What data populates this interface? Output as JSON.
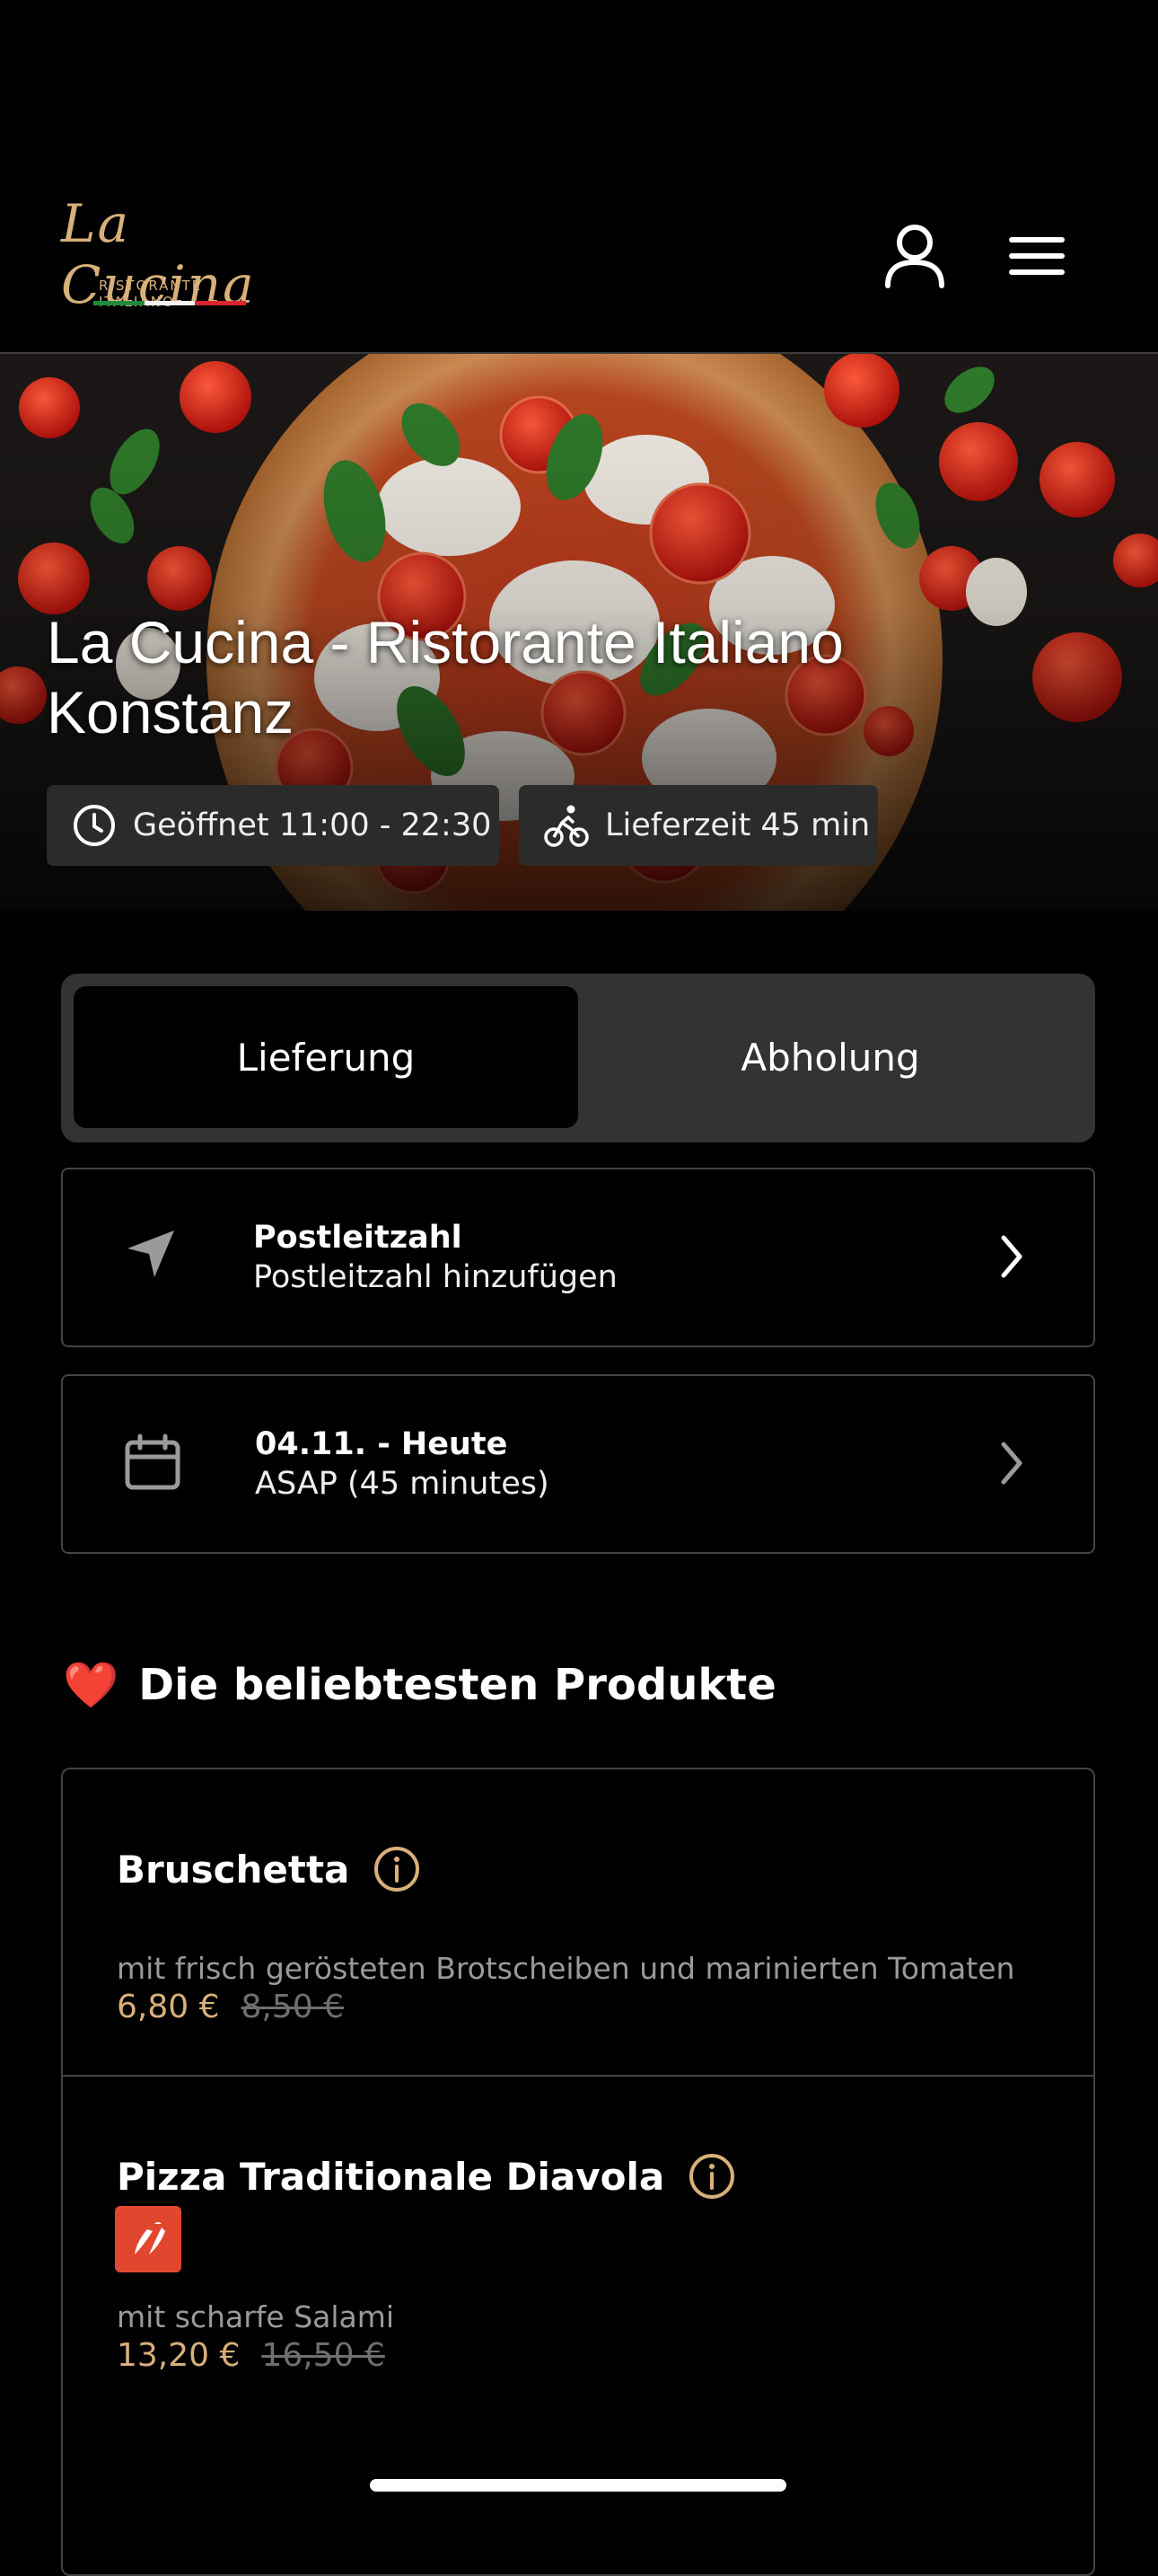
{
  "header": {
    "logo_script": "La Cucina",
    "logo_sub": "RISTORANTE ITALIANO",
    "account_icon": "user-icon",
    "menu_icon": "hamburger-menu-icon"
  },
  "hero": {
    "title_line1": "La Cucina - Ristorante Italiano",
    "title_line2": "Konstanz",
    "opening_chip": "Geöffnet 11:00 - 22:30",
    "opening_icon": "clock-icon",
    "delivery_chip": "Lieferzeit 45 min",
    "delivery_icon": "cyclist-icon"
  },
  "mode_toggle": {
    "delivery_label": "Lieferung",
    "pickup_label": "Abholung",
    "selected": "Lieferung"
  },
  "postcode_row": {
    "icon": "location-arrow-icon",
    "title": "Postleitzahl",
    "subtitle": "Postleitzahl hinzufügen"
  },
  "date_row": {
    "icon": "calendar-icon",
    "title": "04.11. - Heute",
    "subtitle": "ASAP (45 minutes)"
  },
  "popular": {
    "title": "Die beliebtesten Produkte",
    "heart": "❤️",
    "products": [
      {
        "name": "Bruschetta",
        "description": "mit frisch gerösteten Brotscheiben und marinierten Tomaten",
        "price": "6,80 €",
        "old_price": "8,50 €"
      },
      {
        "name": "Pizza Traditionale Diavola",
        "description": "mit scharfe Salami",
        "price": "13,20 €",
        "old_price": "16,50 €",
        "badge_icon": "chili-icon"
      }
    ]
  },
  "colors": {
    "accent_gold": "#d8b07a",
    "chili_red": "#e0472e",
    "heart_red": "#e0212c"
  }
}
